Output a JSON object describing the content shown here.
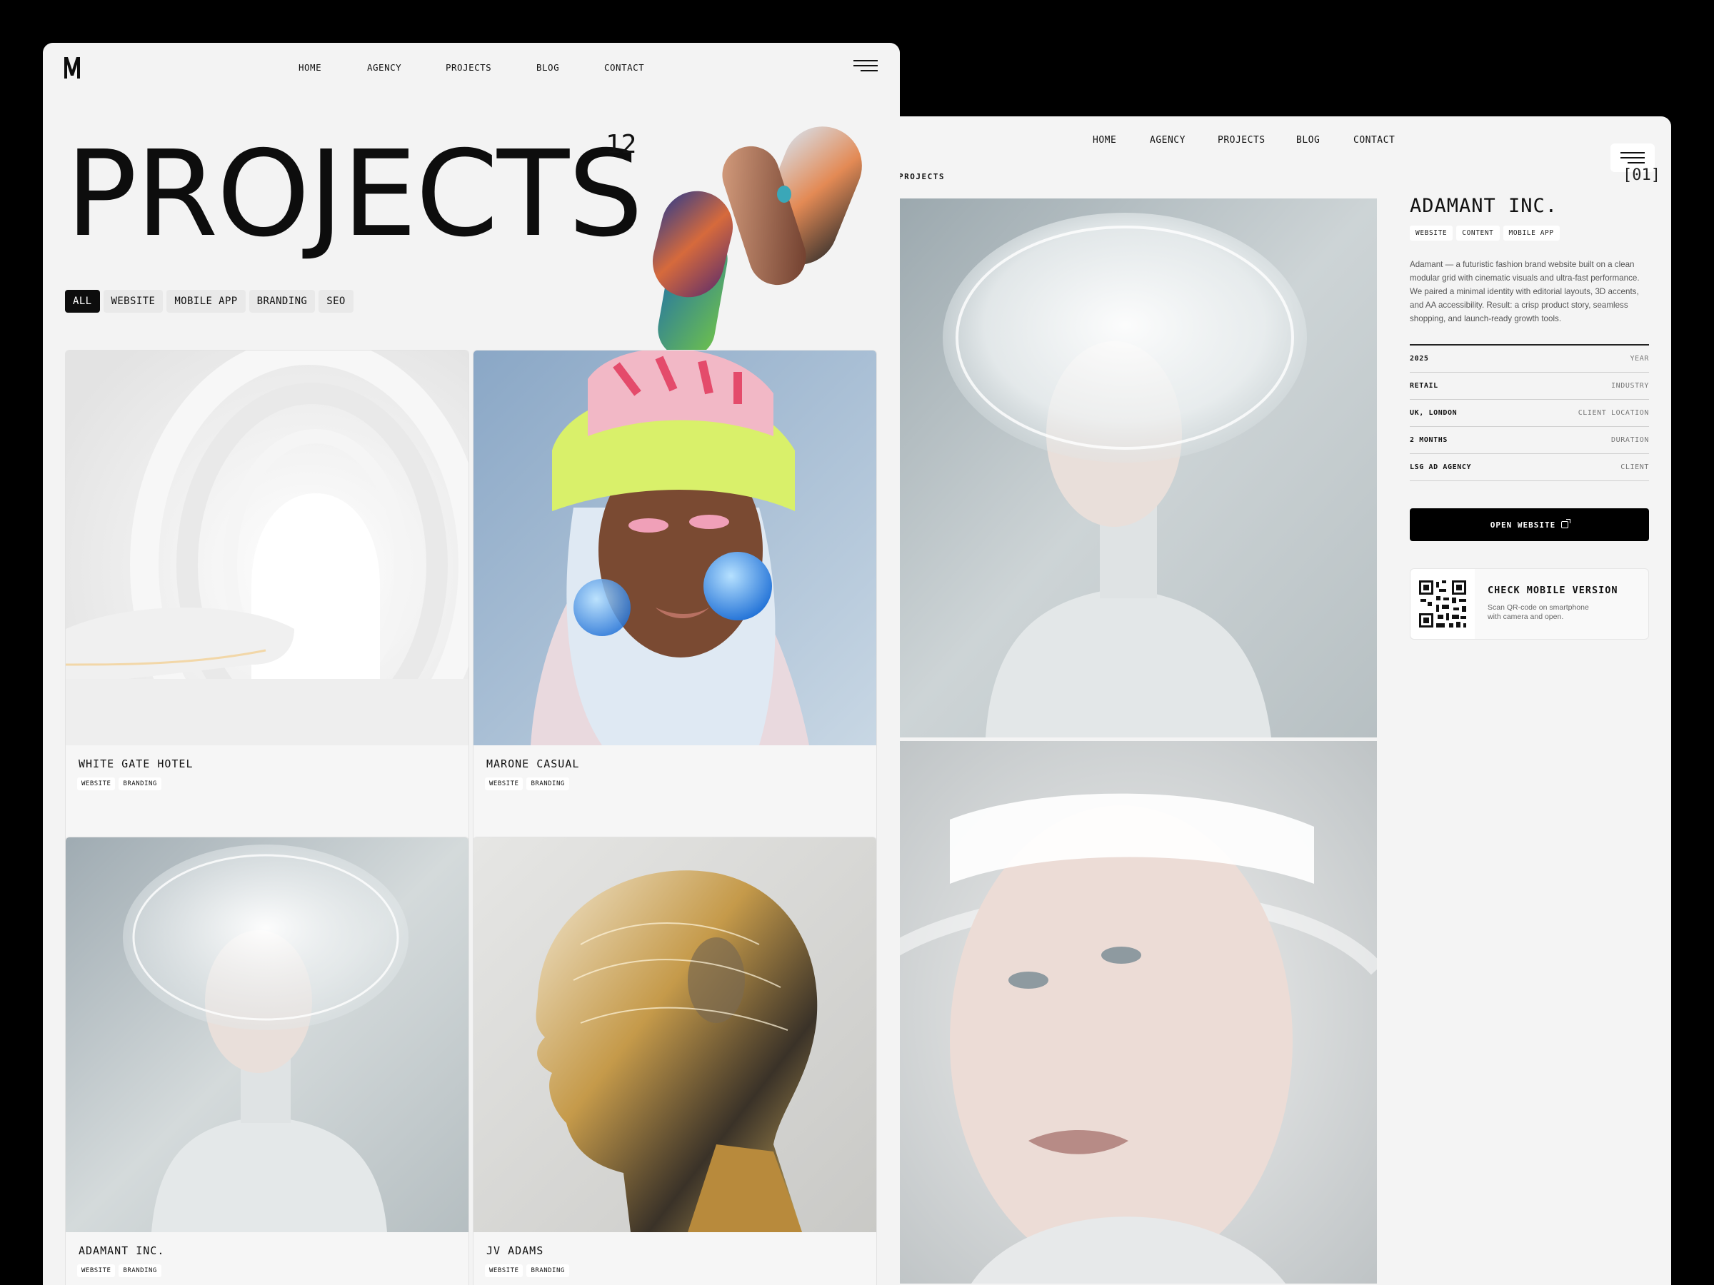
{
  "nav": {
    "home": "HOME",
    "agency": "AGENCY",
    "projects": "PROJECTS",
    "blog": "BLOG",
    "contact": "CONTACT"
  },
  "projects_page": {
    "heading": "PROJECTS",
    "count": "12",
    "filters": [
      "ALL",
      "WEBSITE",
      "MOBILE APP",
      "BRANDING",
      "SEO"
    ],
    "active_filter": "ALL",
    "cards": [
      {
        "name": "WHITE GATE HOTEL",
        "tags": [
          "WEBSITE",
          "BRANDING"
        ]
      },
      {
        "name": "MARONE CASUAL",
        "tags": [
          "WEBSITE",
          "BRANDING"
        ]
      },
      {
        "name": "ADAMANT INC.",
        "tags": [
          "WEBSITE",
          "BRANDING"
        ]
      },
      {
        "name": "JV ADAMS",
        "tags": [
          "WEBSITE",
          "BRANDING"
        ]
      }
    ]
  },
  "detail_page": {
    "breadcrumb": "PROJECTS",
    "index": "[01]",
    "title": "ADAMANT INC.",
    "tags": [
      "WEBSITE",
      "CONTENT",
      "MOBILE APP"
    ],
    "description": "Adamant — a futuristic fashion brand website built on a clean modular grid with cinematic visuals and ultra-fast performance. We paired a minimal identity with editorial layouts, 3D accents, and AA accessibility. Result: a crisp product story, seamless shopping, and launch-ready growth tools.",
    "meta": [
      {
        "value": "2025",
        "label": "YEAR"
      },
      {
        "value": "RETAIL",
        "label": "INDUSTRY"
      },
      {
        "value": "UK, LONDON",
        "label": "CLIENT LOCATION"
      },
      {
        "value": "2 MONTHS",
        "label": "DURATION"
      },
      {
        "value": "LSG AD AGENCY",
        "label": "CLIENT"
      }
    ],
    "open_button": "OPEN WEBSITE",
    "qr_title": "CHECK MOBILE VERSION",
    "qr_subtitle": "Scan QR-code on smartphone with camera and open."
  },
  "colors": {
    "background": "#000000",
    "panel": "#f3f3f3",
    "accent": "#0d0d0d"
  }
}
